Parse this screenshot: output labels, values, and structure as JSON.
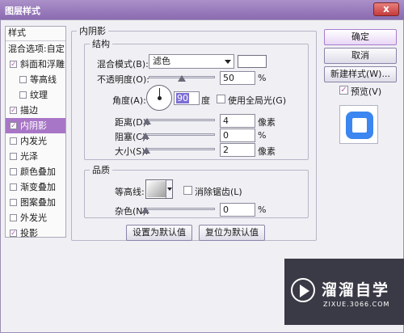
{
  "window": {
    "title": "图层样式",
    "close_label": "x"
  },
  "style_list": {
    "header": "样式",
    "items": [
      {
        "label": "混合选项:自定",
        "checked": null,
        "level": 0,
        "selected": false
      },
      {
        "label": "斜面和浮雕",
        "checked": true,
        "level": 1,
        "selected": false
      },
      {
        "label": "等高线",
        "checked": false,
        "level": 2,
        "selected": false
      },
      {
        "label": "纹理",
        "checked": false,
        "level": 2,
        "selected": false
      },
      {
        "label": "描边",
        "checked": true,
        "level": 1,
        "selected": false
      },
      {
        "label": "内阴影",
        "checked": true,
        "level": 1,
        "selected": true
      },
      {
        "label": "内发光",
        "checked": false,
        "level": 1,
        "selected": false
      },
      {
        "label": "光泽",
        "checked": false,
        "level": 1,
        "selected": false
      },
      {
        "label": "颜色叠加",
        "checked": false,
        "level": 1,
        "selected": false
      },
      {
        "label": "渐变叠加",
        "checked": false,
        "level": 1,
        "selected": false
      },
      {
        "label": "图案叠加",
        "checked": false,
        "level": 1,
        "selected": false
      },
      {
        "label": "外发光",
        "checked": false,
        "level": 1,
        "selected": false
      },
      {
        "label": "投影",
        "checked": true,
        "level": 1,
        "selected": false
      }
    ]
  },
  "panel": {
    "title": "内阴影",
    "structure": {
      "title": "结构",
      "blend_mode_label": "混合模式(B):",
      "blend_mode_value": "滤色",
      "blend_color": "#ffffff",
      "opacity_label": "不透明度(O):",
      "opacity_value": "50",
      "opacity_unit": "%",
      "opacity_fraction": 0.5,
      "angle_label": "角度(A):",
      "angle_value": "90",
      "angle_unit": "度",
      "global_light_label": "使用全局光(G)",
      "global_light_checked": false,
      "distance_label": "距离(D):",
      "distance_value": "4",
      "distance_unit": "像素",
      "choke_label": "阻塞(C):",
      "choke_value": "0",
      "choke_unit": "%",
      "size_label": "大小(S):",
      "size_value": "2",
      "size_unit": "像素"
    },
    "quality": {
      "title": "品质",
      "contour_label": "等高线:",
      "antialias_label": "消除锯齿(L)",
      "antialias_checked": false,
      "noise_label": "杂色(N):",
      "noise_value": "0",
      "noise_unit": "%"
    },
    "set_default_label": "设置为默认值",
    "reset_default_label": "复位为默认值"
  },
  "right": {
    "ok_label": "确定",
    "cancel_label": "取消",
    "new_style_label": "新建样式(W)...",
    "preview_label": "预览(V)",
    "preview_checked": true
  },
  "watermark": {
    "name": "溜溜自学",
    "url": "ZIXUE.3066.COM"
  },
  "colors": {
    "accent": "#a876c6",
    "title_bar": "#9b7fbd",
    "preview_blue": "#3b86f0"
  }
}
